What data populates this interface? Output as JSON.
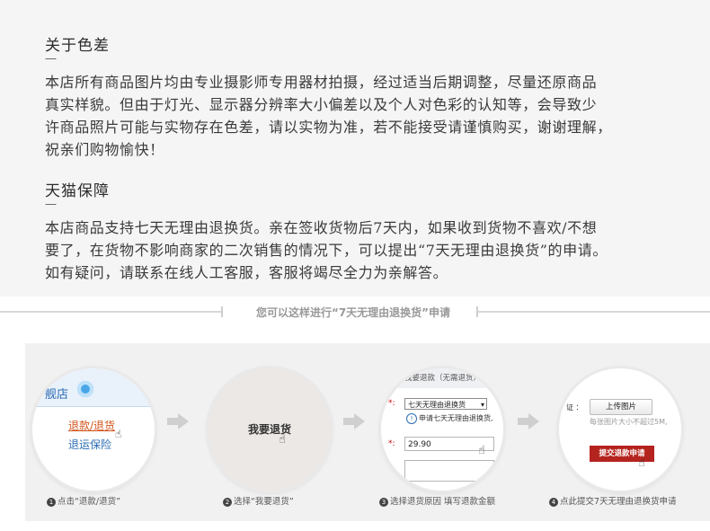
{
  "section1": {
    "title": "关于色差",
    "dash": "—",
    "body": "本店所有商品图片均由专业摄影师专用器材拍摄，经过适当后期调整，尽量还原商品\n真实样貌。但由于灯光、显示器分辨率大小偏差以及个人对色彩的认知等，会导致少\n许商品照片可能与实物存在色差，请以实物为准，若不能接受请谨慎购买，谢谢理解，\n祝亲们购物愉快！"
  },
  "section2": {
    "title": "天猫保障",
    "dash": "—",
    "body": "本店商品支持七天无理由退换货。亲在签收货物后7天内，如果收到货物不喜欢/不想\n要了，在货物不影响商家的二次销售的情况下，可以提出“7天无理由退换货”的申请。\n如有疑问，请联系在线人工客服，客服将竭尽全力为亲解答。"
  },
  "divider_text": "您可以这样进行“7天无理由退换货”申请",
  "steps": [
    {
      "num": "1",
      "label": "点击“退款/退货”",
      "shop": "舰店",
      "link1": "退款/退货",
      "link2": "退运保险"
    },
    {
      "num": "2",
      "label": "选择“我要退货”",
      "button": "我要退货"
    },
    {
      "num": "3",
      "label": "选择退货原因 填写退款金额",
      "header": "我要退款（无需退货）",
      "star": "*:",
      "select": "七天无理由退换货",
      "note": "申请七天无理由退换货,",
      "amount": "29.90"
    },
    {
      "num": "4",
      "label": "点此提交7天无理由退换货申请",
      "field_label": "证 ：",
      "upload": "上传图片",
      "hint": "每张图片大小不超过5M,",
      "submit": "提交退款申请"
    }
  ],
  "colors": {
    "accent_red": "#b5231f",
    "link_orange": "#d2541b",
    "link_blue": "#2b6cb3"
  }
}
